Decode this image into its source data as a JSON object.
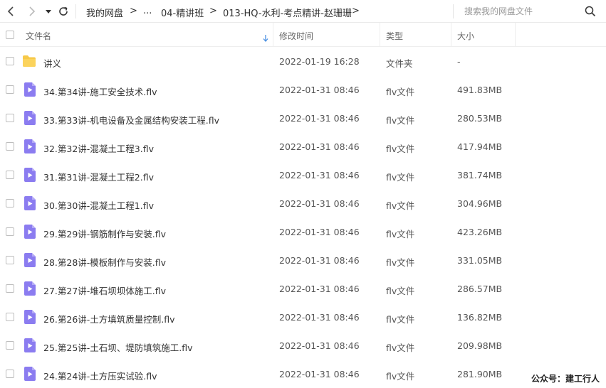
{
  "toolbar": {
    "back_icon": "chevron-left-icon",
    "forward_icon": "chevron-right-icon",
    "history_icon": "caret-down-icon",
    "refresh_icon": "refresh-icon",
    "breadcrumb": [
      "我的网盘",
      "...",
      "04-精讲班",
      "013-HQ-水利-考点精讲-赵珊珊"
    ],
    "separator": ">",
    "search_placeholder": "搜索我的网盘文件",
    "search_icon": "search-icon"
  },
  "header": {
    "name": "文件名",
    "modified": "修改时间",
    "type": "类型",
    "size": "大小",
    "sort_icon": "sort-down-arrow-icon"
  },
  "files": [
    {
      "icon": "folder-icon",
      "name": "讲义",
      "time": "2022-01-19 16:28",
      "type": "文件夹",
      "size": "-"
    },
    {
      "icon": "video-file-icon",
      "name": "34.第34讲-施工安全技术.flv",
      "time": "2022-01-31 08:46",
      "type": "flv文件",
      "size": "491.83MB"
    },
    {
      "icon": "video-file-icon",
      "name": "33.第33讲-机电设备及金属结构安装工程.flv",
      "time": "2022-01-31 08:46",
      "type": "flv文件",
      "size": "280.53MB"
    },
    {
      "icon": "video-file-icon",
      "name": "32.第32讲-混凝土工程3.flv",
      "time": "2022-01-31 08:46",
      "type": "flv文件",
      "size": "417.94MB"
    },
    {
      "icon": "video-file-icon",
      "name": "31.第31讲-混凝土工程2.flv",
      "time": "2022-01-31 08:46",
      "type": "flv文件",
      "size": "381.74MB"
    },
    {
      "icon": "video-file-icon",
      "name": "30.第30讲-混凝土工程1.flv",
      "time": "2022-01-31 08:46",
      "type": "flv文件",
      "size": "304.96MB"
    },
    {
      "icon": "video-file-icon",
      "name": "29.第29讲-钢筋制作与安装.flv",
      "time": "2022-01-31 08:46",
      "type": "flv文件",
      "size": "423.26MB"
    },
    {
      "icon": "video-file-icon",
      "name": "28.第28讲-模板制作与安装.flv",
      "time": "2022-01-31 08:46",
      "type": "flv文件",
      "size": "331.05MB"
    },
    {
      "icon": "video-file-icon",
      "name": "27.第27讲-堆石坝坝体施工.flv",
      "time": "2022-01-31 08:46",
      "type": "flv文件",
      "size": "286.57MB"
    },
    {
      "icon": "video-file-icon",
      "name": "26.第26讲-土方填筑质量控制.flv",
      "time": "2022-01-31 08:46",
      "type": "flv文件",
      "size": "136.82MB"
    },
    {
      "icon": "video-file-icon",
      "name": "25.第25讲-土石坝、堤防填筑施工.flv",
      "time": "2022-01-31 08:46",
      "type": "flv文件",
      "size": "209.98MB"
    },
    {
      "icon": "video-file-icon",
      "name": "24.第24讲-土方压实试验.flv",
      "time": "2022-01-31 08:46",
      "type": "flv文件",
      "size": "281.90MB"
    }
  ],
  "watermark": "公众号：建工行人",
  "colors": {
    "folder": "#f7c948",
    "video_icon": "#8b7cf0",
    "sort_arrow": "#4a90e2",
    "text": "#333333"
  }
}
